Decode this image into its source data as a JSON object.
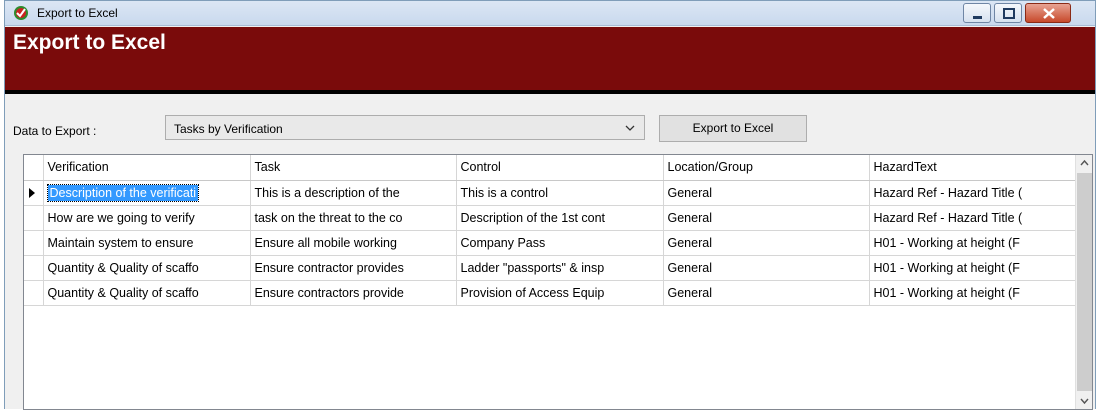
{
  "window": {
    "title": "Export to Excel"
  },
  "banner": {
    "title": "Export to Excel"
  },
  "controls": {
    "data_label": "Data to Export :",
    "data_value": "Tasks by Verification",
    "export_button": "Export to Excel"
  },
  "grid": {
    "columns": [
      "Verification",
      "Task",
      "Control",
      "Location/Group",
      "HazardText"
    ],
    "rows": [
      [
        "Description of the verificati",
        "This is a description of the",
        "This is a control",
        "General",
        "Hazard Ref - Hazard Title ("
      ],
      [
        "How are we going to verify",
        "task on the threat to the co",
        "Description of the 1st cont",
        "General",
        "Hazard Ref - Hazard Title ("
      ],
      [
        "Maintain system to ensure",
        "Ensure all mobile working",
        "Company Pass",
        "General",
        "H01 - Working at height (F"
      ],
      [
        "Quantity & Quality of scaffo",
        "Ensure contractor provides",
        "Ladder \"passports\" & insp",
        "General",
        "H01 - Working at height (F"
      ],
      [
        "Quantity & Quality of scaffo",
        "Ensure contractors provide",
        "Provision of Access Equip",
        "General",
        "H01 - Working at height (F"
      ]
    ],
    "current_row": 0
  },
  "colors": {
    "banner": "#7a0b0b",
    "selection": "#3399ff"
  },
  "icons": {
    "app": "excel-app-icon",
    "minimize": "minimize-icon",
    "maximize": "maximize-icon",
    "close": "close-icon",
    "dropdown": "chevron-down-icon",
    "row_pointer": "row-pointer-icon"
  }
}
